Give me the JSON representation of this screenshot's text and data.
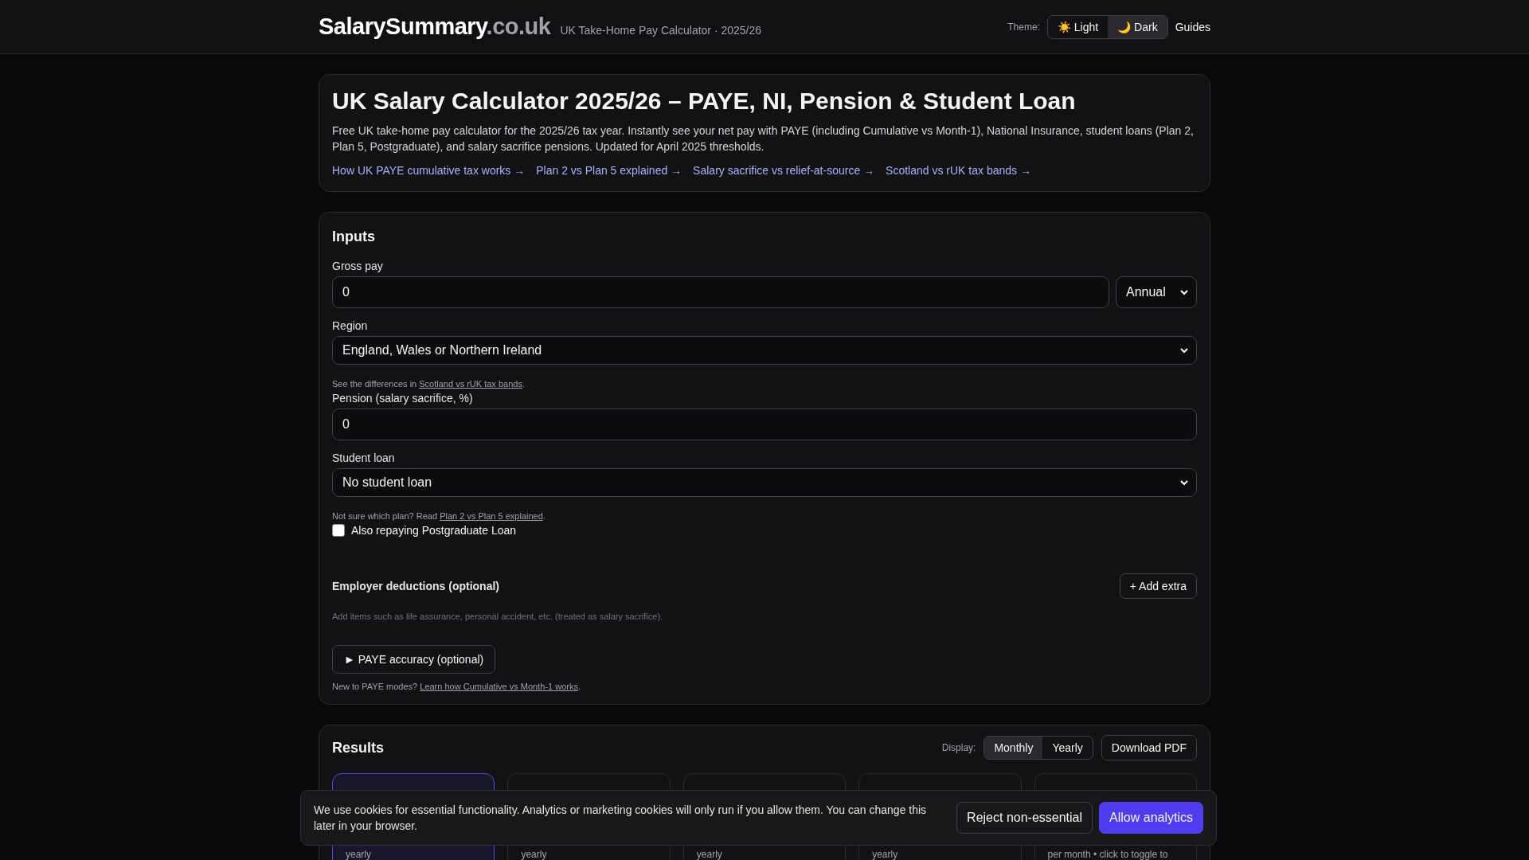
{
  "header": {
    "logo_main": "SalarySummary",
    "logo_tld": ".co.uk",
    "tagline": "UK Take-Home Pay Calculator · 2025/26",
    "theme_label": "Theme:",
    "theme_options": [
      {
        "icon": "☀️",
        "label": "Light",
        "selected": false
      },
      {
        "icon": "🌙",
        "label": "Dark",
        "selected": true
      }
    ],
    "guides_link": "Guides"
  },
  "intro": {
    "title": "UK Salary Calculator 2025/26 – PAYE, NI, Pension & Student Loan",
    "description": "Free UK take-home pay calculator for the 2025/26 tax year. Instantly see your net pay with PAYE (including Cumulative vs Month-1), National Insurance, student loans (Plan 2, Plan 5, Postgraduate), and salary sacrifice pensions. Updated for April 2025 thresholds.",
    "links": [
      "How UK PAYE cumulative tax works →",
      "Plan 2 vs Plan 5 explained →",
      "Salary sacrifice vs relief-at-source →",
      "Scotland vs rUK tax bands →"
    ]
  },
  "inputs": {
    "title": "Inputs",
    "gross_pay": {
      "label": "Gross pay",
      "value": "0",
      "period": "Annual"
    },
    "region": {
      "label": "Region",
      "value": "England, Wales or Northern Ireland",
      "hint": "See the differences in ",
      "hint_link": "Scotland vs rUK tax bands",
      "hint_end": "."
    },
    "pension": {
      "label": "Pension (salary sacrifice, %)",
      "value": "0"
    },
    "student_loan": {
      "label": "Student loan",
      "value": "No student loan",
      "hint": "Not sure which plan? Read ",
      "hint_link": "Plan 2 vs Plan 5 explained",
      "hint_end": "."
    },
    "postgrad": {
      "label": "Also repaying Postgraduate Loan",
      "checked": false
    },
    "employer": {
      "title": "Employer deductions (optional)",
      "add_button": "+ Add extra",
      "description": "Add items such as life assurance, personal accident, etc. (treated as salary sacrifice)."
    },
    "paye": {
      "summary": "► PAYE accuracy (optional)",
      "hint": "New to PAYE modes? ",
      "hint_link": "Learn how Cumulative vs Month-1 works",
      "hint_end": "."
    }
  },
  "results": {
    "title": "Results",
    "display_label": "Display:",
    "display_options": [
      {
        "label": "Monthly",
        "selected": true
      },
      {
        "label": "Yearly",
        "selected": false
      }
    ],
    "download_button": "Download PDF",
    "cards": [
      {
        "caption": "yearly",
        "selected": true
      },
      {
        "caption": "yearly",
        "selected": false
      },
      {
        "caption": "yearly",
        "selected": false
      },
      {
        "caption": "yearly",
        "selected": false
      },
      {
        "caption": "per month • click to toggle to",
        "selected": false
      }
    ]
  },
  "cookie_banner": {
    "text": "We use cookies for essential functionality. Analytics or marketing cookies will only run if you allow them. You can change this later in your browser.",
    "reject_button": "Reject non-essential",
    "allow_button": "Allow analytics"
  }
}
